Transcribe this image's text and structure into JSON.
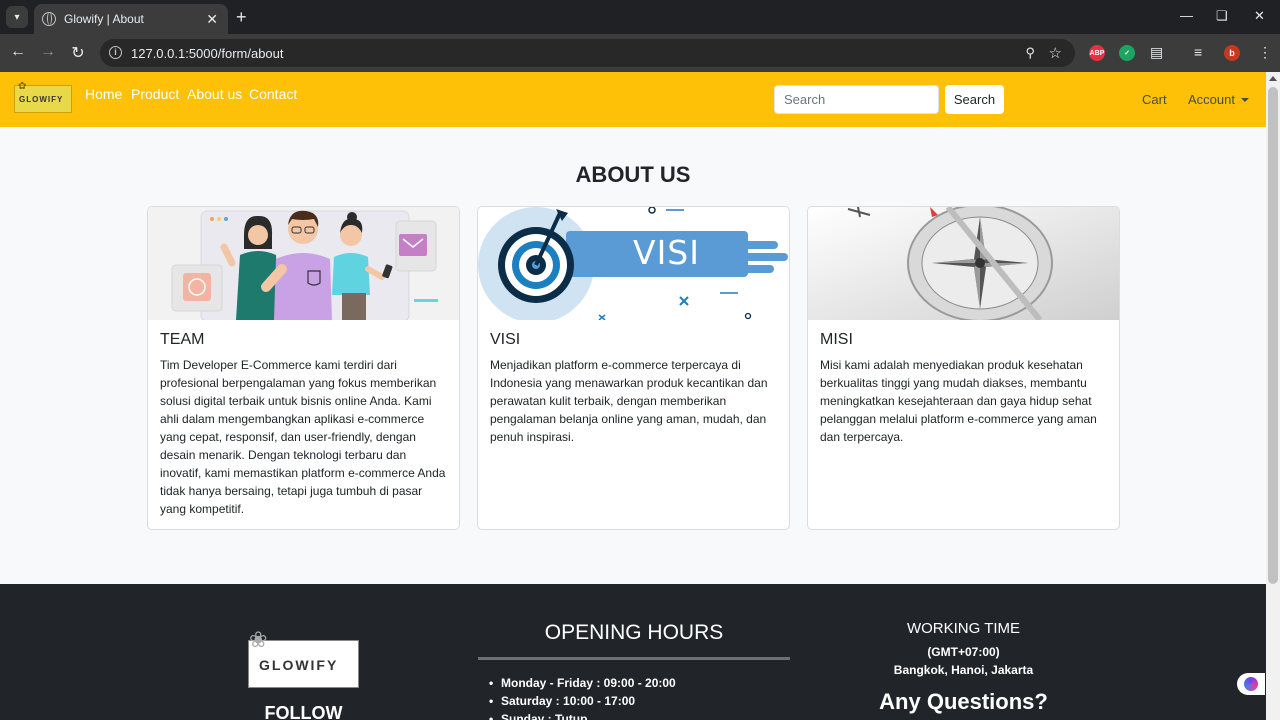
{
  "browser": {
    "tab_title": "Glowify | About",
    "url": "127.0.0.1:5000/form/about",
    "extensions": [
      {
        "name": "adblock-plus-icon",
        "label": "ABP",
        "color": "#e7313e"
      },
      {
        "name": "shield-extension-icon",
        "color": "#1da462"
      },
      {
        "name": "profile-avatar",
        "label": "b",
        "color": "#c5391c"
      }
    ]
  },
  "navbar": {
    "logo_text": "GLOWIFY",
    "links": [
      "Home",
      "Product",
      "About us",
      "Contact"
    ],
    "search_placeholder": "Search",
    "search_button": "Search",
    "cart": "Cart",
    "account": "Account",
    "brand_color": "#ffc107"
  },
  "main": {
    "heading": "ABOUT US",
    "cards": [
      {
        "title": "TEAM",
        "image": "team-illustration",
        "text": "Tim Developer E-Commerce kami terdiri dari profesional berpengalaman yang fokus memberikan solusi digital terbaik untuk bisnis online Anda. Kami ahli dalam mengembangkan aplikasi e-commerce yang cepat, responsif, dan user-friendly, dengan desain menarik. Dengan teknologi terbaru dan inovatif, kami memastikan platform e-commerce Anda tidak hanya bersaing, tetapi juga tumbuh di pasar yang kompetitif."
      },
      {
        "title": "VISI",
        "image": "visi-target-banner",
        "image_caption": "VISI",
        "text": "Menjadikan platform e-commerce terpercaya di Indonesia yang menawarkan produk kecantikan dan perawatan kulit terbaik, dengan memberikan pengalaman belanja online yang aman, mudah, dan penuh inspirasi."
      },
      {
        "title": "MISI",
        "image": "compass-photo",
        "text": "Misi kami adalah menyediakan produk kesehatan berkualitas tinggi yang mudah diakses, membantu meningkatkan kesejahteraan dan gaya hidup sehat pelanggan melalui platform e-commerce yang aman dan terpercaya."
      }
    ]
  },
  "footer": {
    "logo_text": "GLOWIFY",
    "follow": "FOLLOW",
    "opening_hours": {
      "title": "OPENING HOURS",
      "items": [
        "Monday - Friday : 09:00 - 20:00",
        "Saturday : 10:00 - 17:00",
        "Sunday : Tutup"
      ]
    },
    "working_time": {
      "title": "WORKING TIME",
      "timezone": "(GMT+07:00)",
      "cities": "Bangkok, Hanoi, Jakarta"
    },
    "questions": "Any Questions?"
  }
}
